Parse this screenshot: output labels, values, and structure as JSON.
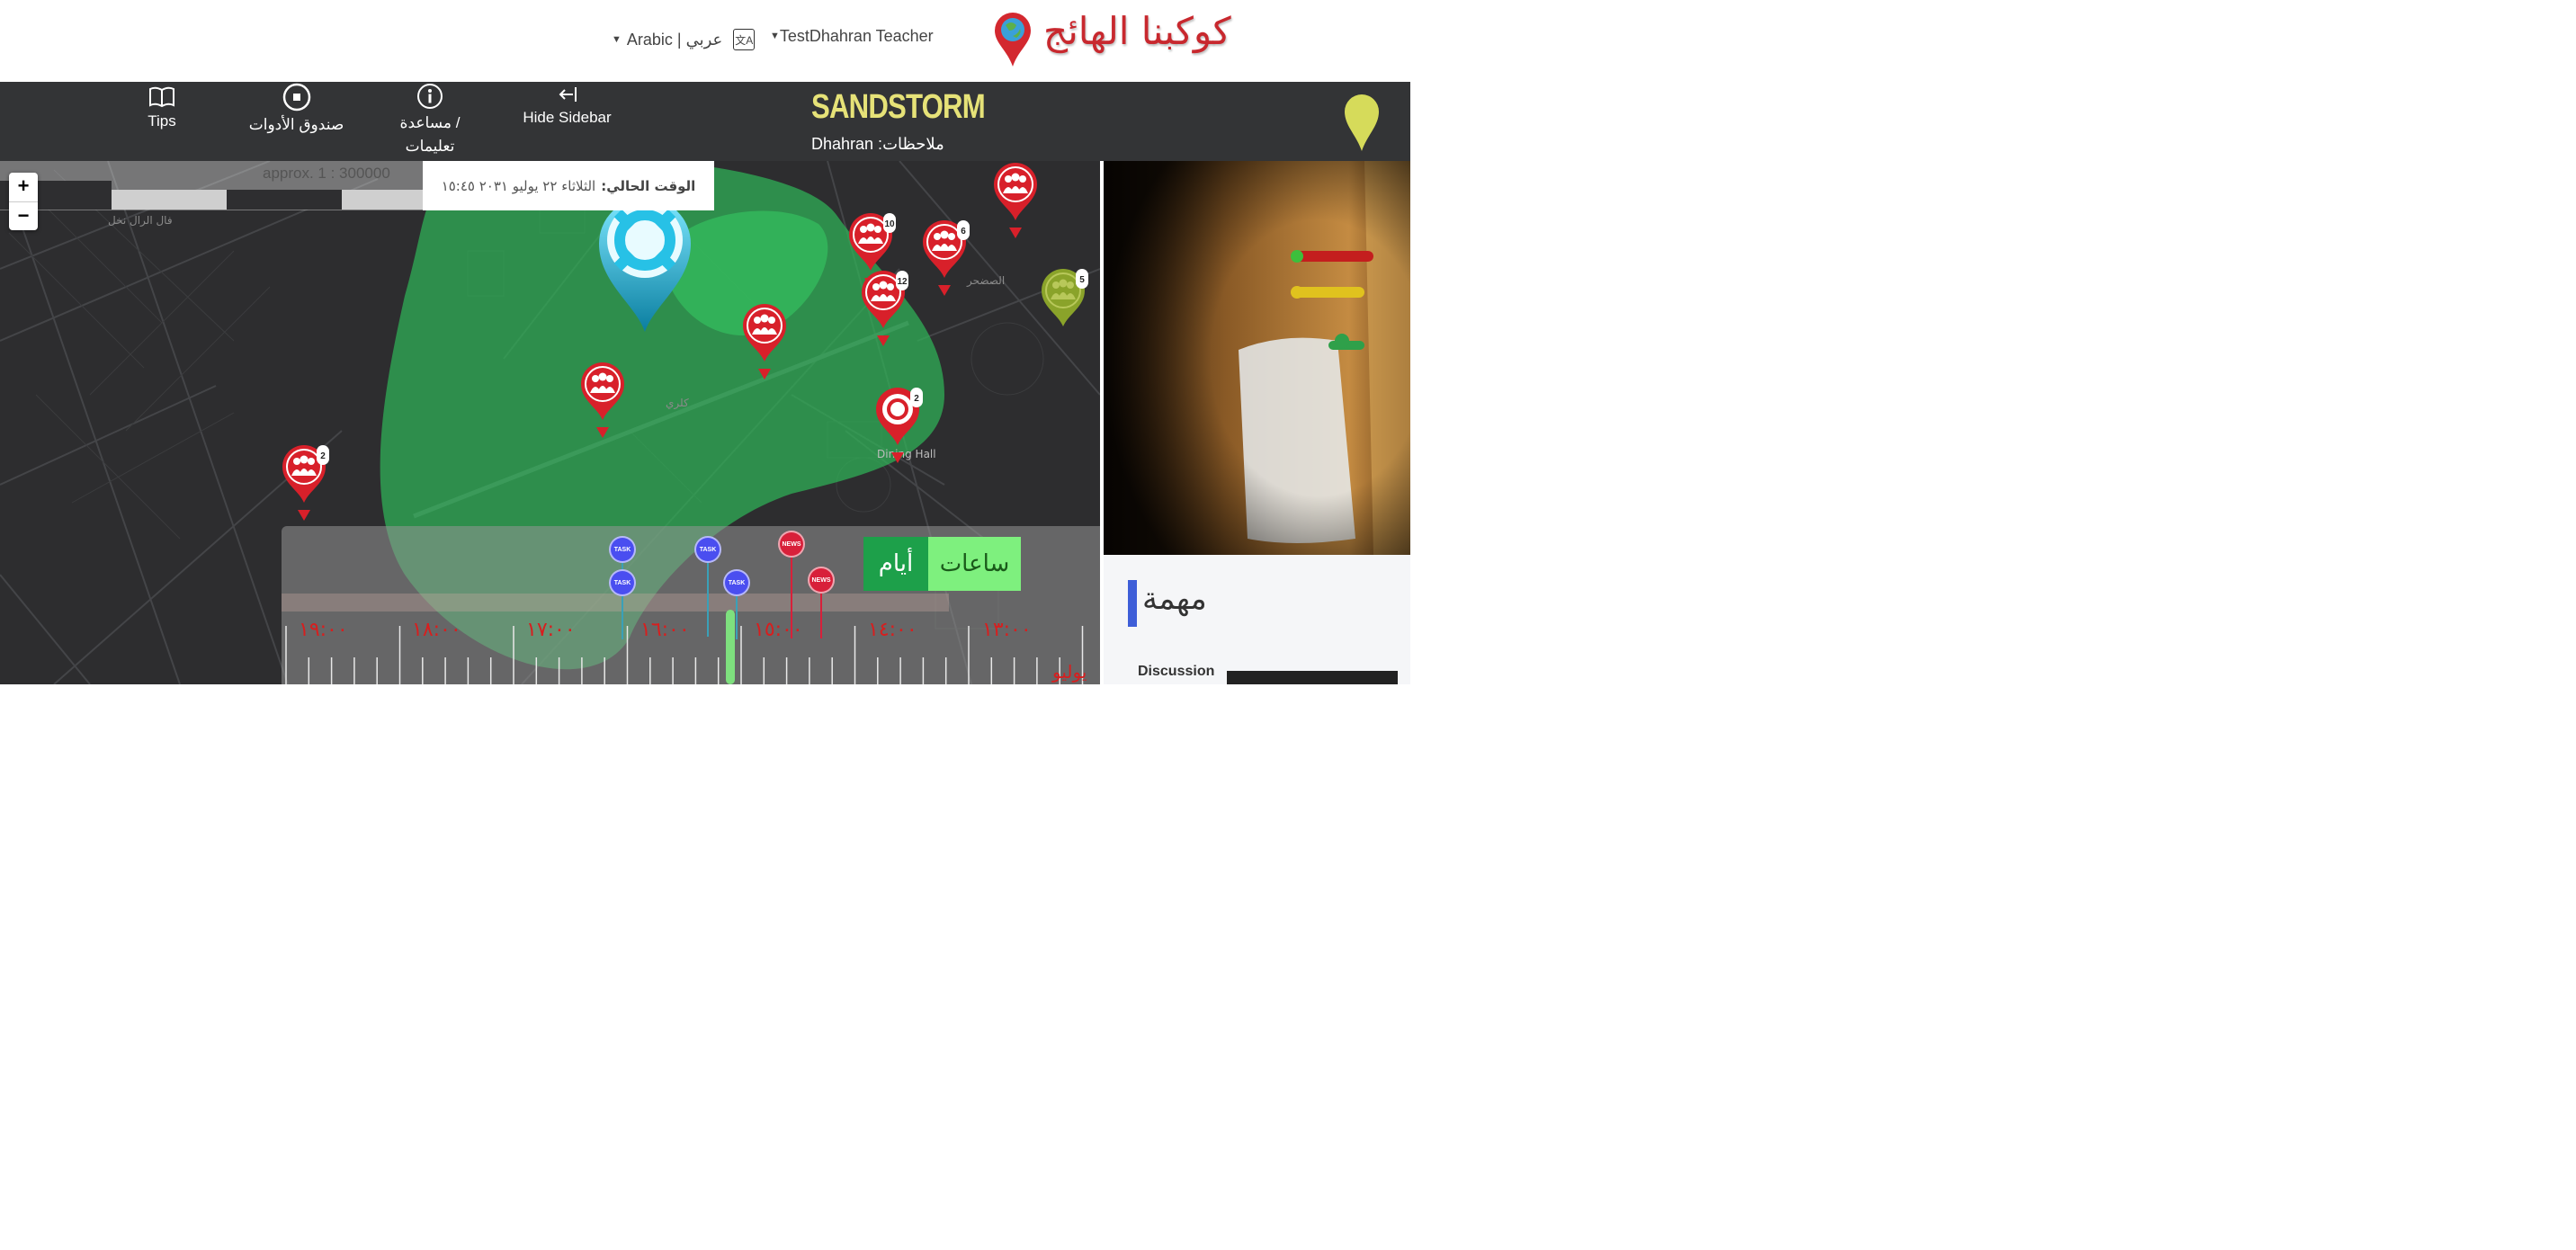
{
  "header": {
    "logo_text": "كوكبنا الهائج",
    "user_menu": "TestDhahran Teacher",
    "language_menu": "Arabic | عربي"
  },
  "toolbar": {
    "tips": "Tips",
    "toolbox": "صندوق الأدوات",
    "help_line1": "مساعدة /",
    "help_line2": "تعليمات",
    "hide_sidebar": "Hide Sidebar",
    "brand": "SANDSTORM",
    "location_notes": "Dhahran :ملاحظات"
  },
  "map": {
    "scale": "approx. 1 : 300000",
    "current_time_label": "الوقت الحالي:",
    "current_time_value": "الثلاثاء ٢٢ يوليو ٢٠٣١ ١٥:٤٥",
    "zoom_in": "+",
    "zoom_out": "−",
    "place_labels": [
      "فال الرال نخل",
      "Dining Hall",
      "كلري",
      "الصضحر"
    ],
    "markers": [
      {
        "type": "group",
        "color": "red",
        "badge": ""
      },
      {
        "type": "group",
        "color": "red",
        "badge": "10"
      },
      {
        "type": "group",
        "color": "red",
        "badge": "6"
      },
      {
        "type": "group",
        "color": "red",
        "badge": "12"
      },
      {
        "type": "group",
        "color": "green",
        "badge": "5"
      },
      {
        "type": "group",
        "color": "red",
        "badge": ""
      },
      {
        "type": "group",
        "color": "red",
        "badge": ""
      },
      {
        "type": "target",
        "color": "red",
        "badge": "2"
      },
      {
        "type": "group",
        "color": "red",
        "badge": "2"
      },
      {
        "type": "lifebuoy",
        "color": "cyan",
        "badge": ""
      }
    ]
  },
  "timeline": {
    "hours_button": "ساعات",
    "days_button": "أيام",
    "hour_labels": [
      "١٩:٠٠",
      "١٨:٠٠",
      "١٧:٠٠",
      "١٦:٠٠",
      "١٥:٠٠",
      "١٤:٠٠",
      "١٣:٠٠"
    ],
    "month_label": "يوليو",
    "events": [
      {
        "kind": "TASK",
        "color": "#4a4ef0"
      },
      {
        "kind": "TASK",
        "color": "#4a4ef0"
      },
      {
        "kind": "TASK",
        "color": "#4a4ef0"
      },
      {
        "kind": "TASK",
        "color": "#4a4ef0"
      },
      {
        "kind": "NEWS",
        "color": "#d8203a"
      },
      {
        "kind": "NEWS",
        "color": "#d8203a"
      }
    ]
  },
  "sidebar": {
    "task_title": "مهمة",
    "discussion_label": "Discussion"
  },
  "colors": {
    "brand": "#e6e278",
    "toolbar_bg": "#333436",
    "map_bg": "#2d2d2f",
    "zone": "#2fb457",
    "timeline_red": "#d81e1e"
  }
}
